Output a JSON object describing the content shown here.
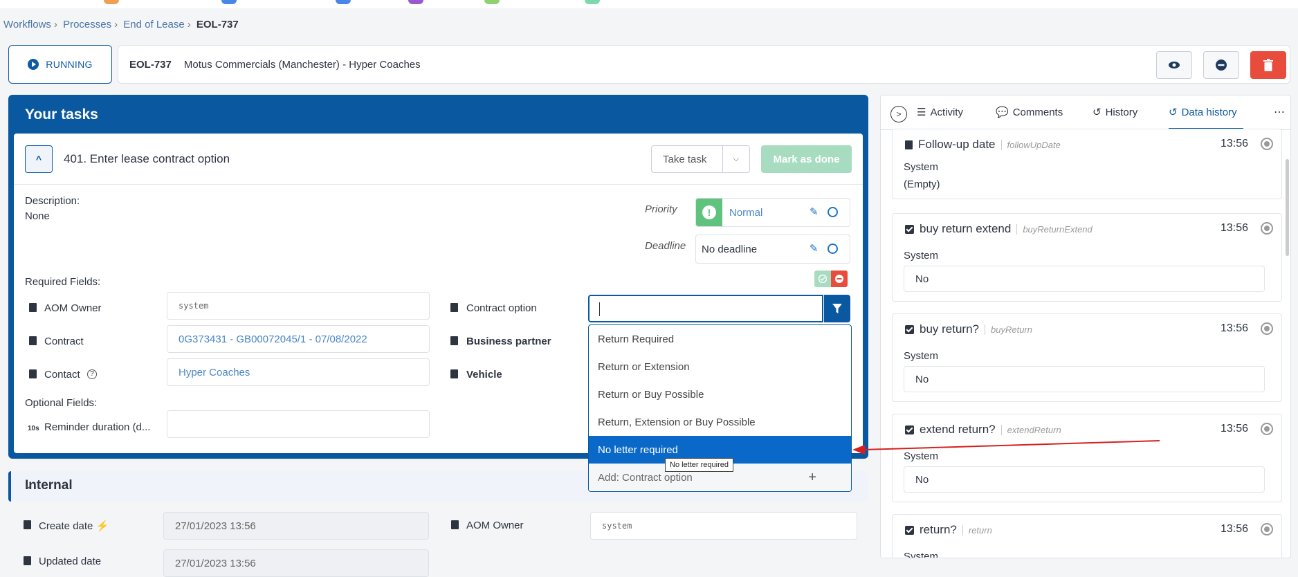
{
  "breadcrumb": [
    "Workflows",
    "Processes",
    "End of Lease",
    "EOL-737"
  ],
  "status_button": "RUNNING",
  "process": {
    "id": "EOL-737",
    "title": "Motus Commercials (Manchester) - Hyper Coaches"
  },
  "tasks": {
    "title": "Your tasks",
    "task_name": "401. Enter lease contract option",
    "take_task": "Take task",
    "mark_done": "Mark as done",
    "description_label": "Description:",
    "description_value": "None",
    "priority_label": "Priority",
    "priority_value": "Normal",
    "deadline_label": "Deadline",
    "deadline_value": "No deadline",
    "required_label": "Required Fields:",
    "optional_label": "Optional Fields:",
    "fields": {
      "aom_owner_label": "AOM Owner",
      "aom_owner_value": "system",
      "contract_label": "Contract",
      "contract_value": "0G373431 - GB00072045/1 - 07/08/2022",
      "contact_label": "Contact",
      "contact_value": "Hyper Coaches",
      "contract_option_label": "Contract option",
      "business_partner_label": "Business partner",
      "vehicle_label": "Vehicle",
      "reminder_label": "Reminder duration (d...",
      "reminder_icon": "10s"
    }
  },
  "dropdown": {
    "options": [
      "Return Required",
      "Return or Extension",
      "Return or Buy Possible",
      "Return, Extension or Buy Possible",
      "No letter required"
    ],
    "selected_index": 4,
    "add_label": "Add: Contract option",
    "tooltip": "No letter required"
  },
  "internal": {
    "title": "Internal",
    "create_date_label": "Create date",
    "create_date_value": "27/01/2023 13:56",
    "aom_owner_label": "AOM Owner",
    "aom_owner_value": "system",
    "updated_label": "Updated date",
    "updated_value": "27/01/2023 13:56"
  },
  "right_panel": {
    "tabs": [
      "Activity",
      "Comments",
      "History",
      "Data history"
    ],
    "active_tab": "Data history",
    "entries": [
      {
        "title": "Follow-up date",
        "key": "followUpDate",
        "time": "13:56",
        "source": "System",
        "value": "(Empty)"
      },
      {
        "title": "buy return extend",
        "key": "buyReturnExtend",
        "time": "13:56",
        "source": "System",
        "value": "No"
      },
      {
        "title": "buy return?",
        "key": "buyReturn",
        "time": "13:56",
        "source": "System",
        "value": "No"
      },
      {
        "title": "extend return?",
        "key": "extendReturn",
        "time": "13:56",
        "source": "System",
        "value": "No"
      },
      {
        "title": "return?",
        "key": "return",
        "time": "13:56",
        "source": "System",
        "value": ""
      }
    ]
  },
  "colors": {
    "primary": "#0a58a0",
    "danger": "#e74c3c",
    "success": "#5fc27d",
    "arrow": "#d62020"
  }
}
